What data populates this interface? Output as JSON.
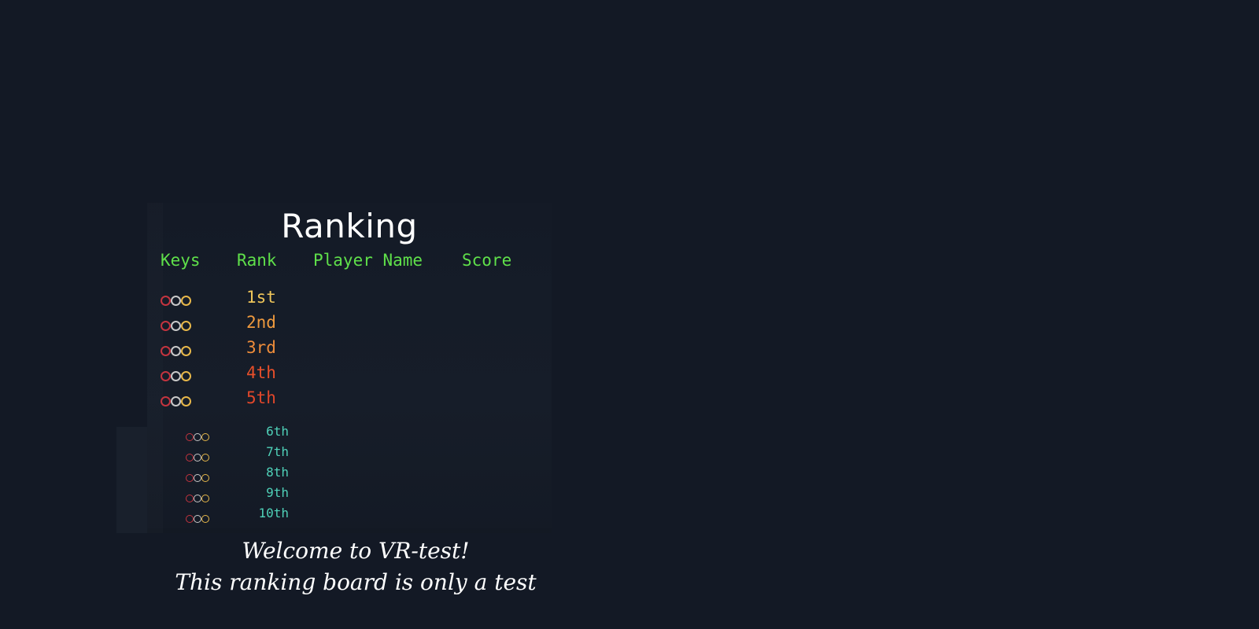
{
  "board": {
    "title": "Ranking",
    "headers": {
      "keys": "Keys",
      "rank": "Rank",
      "player": "Player Name",
      "score": "Score"
    },
    "key_colors": [
      "#c4343f",
      "#c9c9c9",
      "#e8b84a"
    ],
    "top_ranks": [
      {
        "rank": "1st",
        "color": "#efc65a",
        "player": "",
        "score": ""
      },
      {
        "rank": "2nd",
        "color": "#ef9a3e",
        "player": "",
        "score": ""
      },
      {
        "rank": "3rd",
        "color": "#ee8c3a",
        "player": "",
        "score": ""
      },
      {
        "rank": "4th",
        "color": "#e84f2a",
        "player": "",
        "score": ""
      },
      {
        "rank": "5th",
        "color": "#e2472a",
        "player": "",
        "score": ""
      }
    ],
    "other_ranks": [
      {
        "rank": "6th",
        "player": "",
        "score": ""
      },
      {
        "rank": "7th",
        "player": "",
        "score": ""
      },
      {
        "rank": "8th",
        "player": "",
        "score": ""
      },
      {
        "rank": "9th",
        "player": "",
        "score": ""
      },
      {
        "rank": "10th",
        "player": "",
        "score": ""
      }
    ],
    "other_rank_color": "#4fd1b8",
    "header_color": "#5fe04a"
  },
  "footer": {
    "line1": "Welcome to VR-test!",
    "line2": "This ranking board is only a test"
  }
}
